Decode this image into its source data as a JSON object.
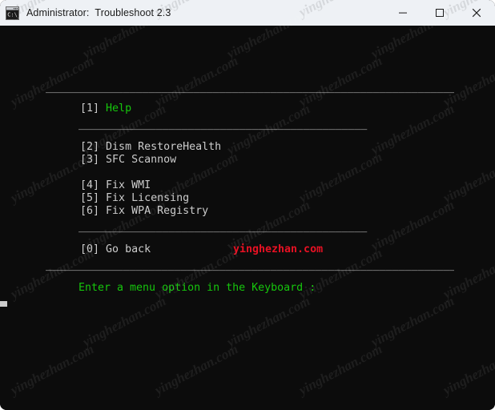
{
  "window": {
    "title": "Administrator:  Troubleshoot 2.3",
    "icon": "console-icon",
    "controls": {
      "minimize": "minimize-icon",
      "maximize": "maximize-icon",
      "close": "close-icon"
    },
    "titlebar_bg": "#eef1f5",
    "console_bg": "#0c0c0c"
  },
  "console": {
    "separators": {
      "full": "________________________________________________________________",
      "short": "_____________________________________________"
    },
    "menu": [
      {
        "key": "[1]",
        "label": "Help",
        "color": "#16c60c"
      },
      {
        "key": "[2]",
        "label": "Dism RestoreHealth",
        "color": "#cccccc"
      },
      {
        "key": "[3]",
        "label": "SFC Scannow",
        "color": "#cccccc"
      },
      {
        "key": "[4]",
        "label": "Fix WMI",
        "color": "#cccccc"
      },
      {
        "key": "[5]",
        "label": "Fix Licensing",
        "color": "#cccccc"
      },
      {
        "key": "[6]",
        "label": "Fix WPA Registry",
        "color": "#cccccc"
      },
      {
        "key": "[0]",
        "label": "Go back",
        "color": "#cccccc"
      }
    ],
    "prompt": "Enter a menu option in the Keyboard :",
    "prompt_color": "#16c60c",
    "watermark_text": "yinghezhan.com",
    "watermark_color": "#e81123",
    "cursor": "block-cursor"
  },
  "overlay_watermark": "yinghezhan.com"
}
